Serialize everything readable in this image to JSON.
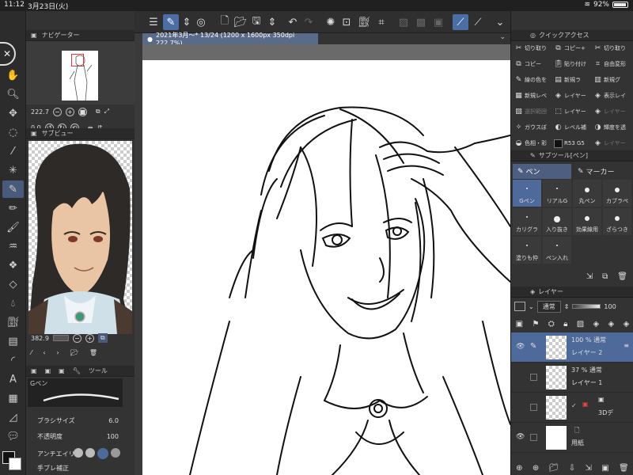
{
  "status": {
    "time": "11:12",
    "date": "3月23日(火)",
    "battery": "92%"
  },
  "navigator": {
    "title": "ナビゲーター",
    "zoom": "222.7",
    "rotation": "0.0"
  },
  "subview": {
    "title": "サブビュー",
    "zoom": "382.9"
  },
  "tool_property": {
    "tab_label": "ツール",
    "brush_name": "Gペン",
    "brush_size_label": "ブラシサイズ",
    "brush_size": "6.0",
    "opacity_label": "不透明度",
    "opacity": "100",
    "antialias_label": "アンチエイリ",
    "stabilize_label": "手ブレ補正"
  },
  "canvas": {
    "tab_label": "2021年3月〜* 13/24 (1200 x 1600px 350dpi 222.7%)"
  },
  "quick_access": {
    "title": "クイックアクセス",
    "items": [
      [
        "切り取り",
        "コピー+",
        "切り取り"
      ],
      [
        "コピー",
        "貼り付け",
        "自由変形"
      ],
      [
        "線の色を",
        "新規ラ",
        "新規グ"
      ],
      [
        "新規レベ",
        "レイヤー",
        "表示レイ"
      ],
      [
        "選択範囲",
        "レイヤー",
        "レイヤー"
      ],
      [
        "ガウスぼ",
        "レベル補",
        "輝度を透"
      ],
      [
        "色相・彩",
        "R53 G5",
        "レイヤー"
      ]
    ]
  },
  "sub_tool": {
    "title": "サブツール[ペン]",
    "tabs": [
      "ペン",
      "マーカー"
    ],
    "brushes": [
      "Gペン",
      "リアルG",
      "丸ペン",
      "カブラペ",
      "カリグラ",
      "入り抜き",
      "効果線用",
      "ざらつき",
      "塗りも仲",
      "ペン入れ"
    ]
  },
  "layer": {
    "title": "レイヤー",
    "blend": "通常",
    "opacity": "100",
    "rows": [
      {
        "percent_mode": "100 % 通常",
        "name": "レイヤー 2"
      },
      {
        "percent_mode": "37 % 通常",
        "name": "レイヤー 1"
      },
      {
        "percent_mode": "",
        "name": "3Dデ"
      },
      {
        "percent_mode": "",
        "name": "用紙"
      }
    ]
  }
}
